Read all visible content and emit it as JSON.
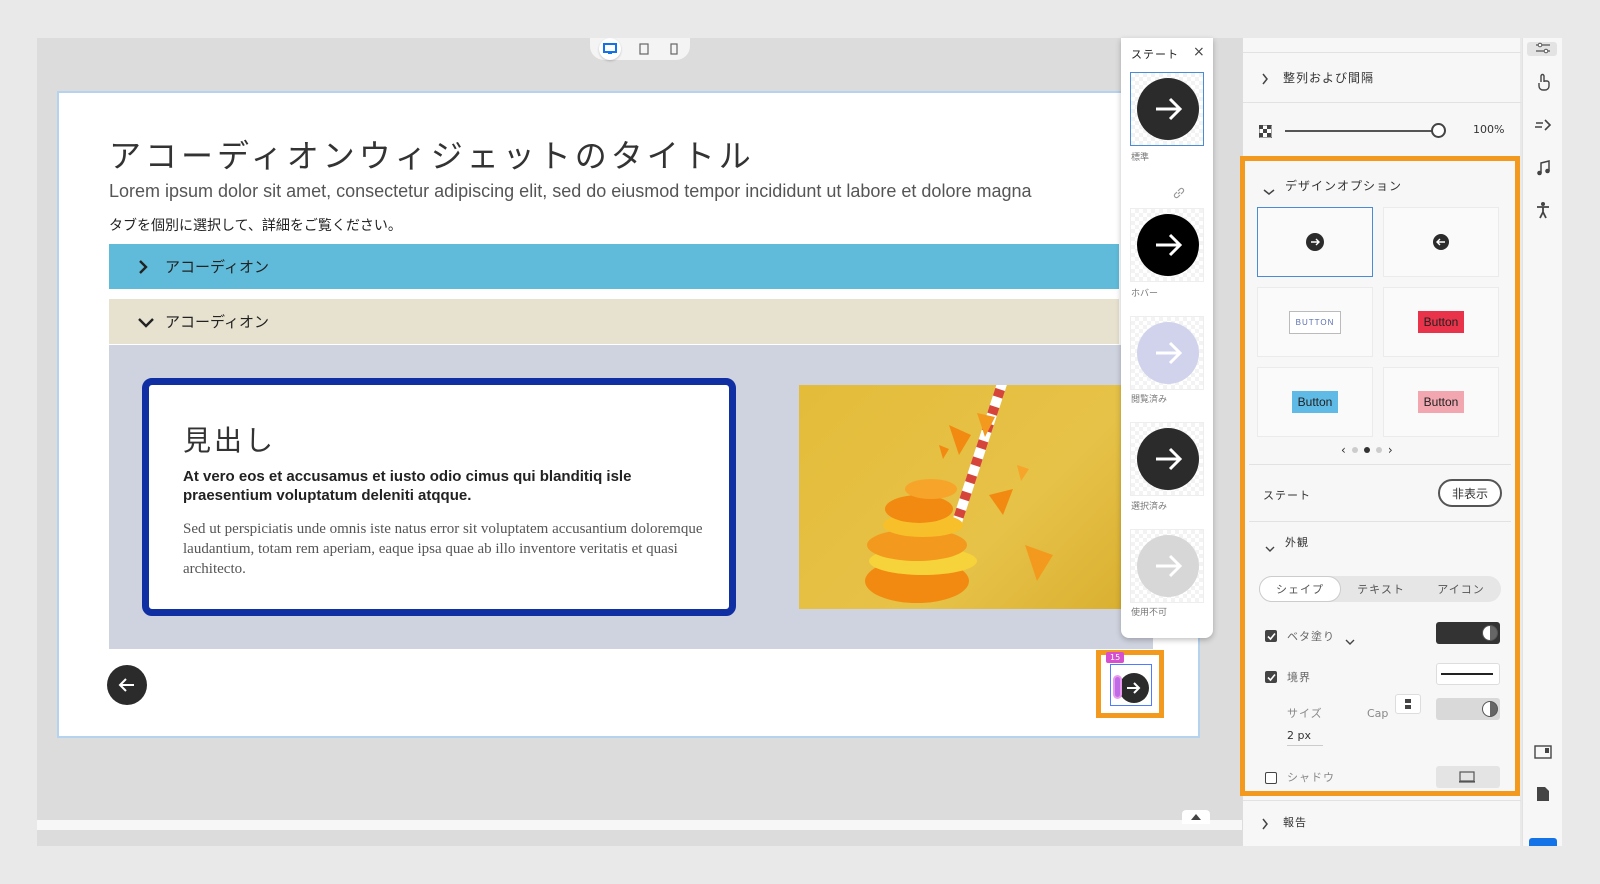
{
  "canvas": {
    "device_toggle": [
      "desktop",
      "tablet",
      "phone"
    ],
    "widget": {
      "title": "アコーディオンウィジェットのタイトル",
      "description": "Lorem ipsum dolor sit amet, consectetur adipiscing elit, sed do eiusmod tempor incididunt ut labore et dolore magna",
      "subtitle": "タブを個別に選択して、詳細をご覧ください。",
      "accordions": [
        {
          "label": "アコーディオン",
          "expanded": false,
          "color": "#5fbbd9"
        },
        {
          "label": "アコーディオン",
          "expanded": true,
          "color": "#e7e1cf"
        }
      ],
      "card": {
        "heading": "見出し",
        "bold_text": "At vero eos et accusamus et iusto odio cimus qui blanditiq isle praesentium voluptatum deleniti atqque.",
        "body_text": "Sed ut perspiciatis unde omnis iste natus error sit voluptatem accusantium doloremque laudantium, totam rem aperiam, eaque ipsa quae ab illo inventore veritatis et quasi architecto."
      },
      "next_tag": "15"
    }
  },
  "state_popover": {
    "title": "ステート",
    "close": "×",
    "states": [
      {
        "label": "標準",
        "color": "#2b2b2b",
        "arrow": "#ffffff"
      },
      {
        "label": "ホバー",
        "color": "#000000",
        "arrow": "#ffffff"
      },
      {
        "label": "閲覧済み",
        "color": "#d1d3ec",
        "arrow": "#ffffff"
      },
      {
        "label": "選択済み",
        "color": "#2b2b2b",
        "arrow": "#ffffff"
      },
      {
        "label": "使用不可",
        "color": "#d7d7d7",
        "arrow": "#ffffff"
      }
    ]
  },
  "panel": {
    "align_label": "整列および間隔",
    "opacity_value": "100%",
    "opacity_level": 1.0,
    "design_options_label": "デザインオプション",
    "options": [
      {
        "type": "circle-large",
        "label": ""
      },
      {
        "type": "circle-small",
        "label": ""
      },
      {
        "type": "text",
        "label": "BUTTON"
      },
      {
        "type": "red",
        "label": "Button"
      },
      {
        "type": "blue",
        "label": "Button"
      },
      {
        "type": "pink",
        "label": "Button"
      }
    ],
    "pager": {
      "prev": "‹",
      "next": "›",
      "pages": 3,
      "current": 2
    },
    "state_label": "ステート",
    "hide_button": "非表示",
    "appearance_label": "外観",
    "tabs": [
      "シェイプ",
      "テキスト",
      "アイコン"
    ],
    "active_tab": 0,
    "fill_label": "ベタ塗り",
    "fill_color": "#333333",
    "border_label": "境界",
    "size_label": "サイズ",
    "cap_label": "Cap",
    "size_value": "2 px",
    "shadow_label": "シャドウ",
    "report_label": "報告"
  },
  "colors": {
    "highlight_orange": "#f39a1e",
    "selection_blue": "#4b8bd6",
    "card_border": "#0f2fa3"
  }
}
